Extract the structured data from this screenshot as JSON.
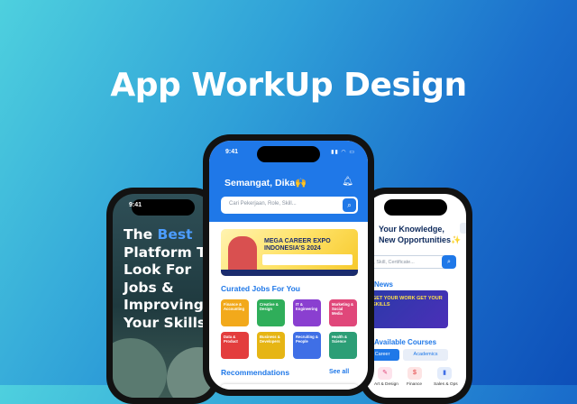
{
  "headline": "App WorkUp Design",
  "status_time": "9:41",
  "left_phone": {
    "lines": [
      {
        "pre": "The ",
        "accent": "Best",
        "post": ""
      },
      {
        "pre": "Platform T",
        "accent": "",
        "post": ""
      },
      {
        "pre": "Look For",
        "accent": "",
        "post": ""
      },
      {
        "pre": "Jobs &",
        "accent": "",
        "post": ""
      },
      {
        "pre": "Improving",
        "accent": "",
        "post": ""
      },
      {
        "pre": "Your Skills",
        "accent": "",
        "post": ""
      }
    ]
  },
  "center_phone": {
    "greeting": "Semangat, Dika🙌",
    "search_placeholder": "Cari Pekerjaan, Role, Skill...",
    "banner_title": "MEGA CAREER EXPO INDONESIA'S 2024",
    "curated_title": "Curated Jobs For You",
    "categories": [
      {
        "label": "Finance & Accounting",
        "color": "#f2a91b"
      },
      {
        "label": "Creative & Design",
        "color": "#2fae5a"
      },
      {
        "label": "IT & Engineering",
        "color": "#8a3fd0"
      },
      {
        "label": "Marketing & Social Media",
        "color": "#e0477a"
      },
      {
        "label": "Data & Product",
        "color": "#e33d3d"
      },
      {
        "label": "Business & Developers",
        "color": "#e6b514"
      },
      {
        "label": "Recruiting & People",
        "color": "#3f6fe6"
      },
      {
        "label": "Health & Science",
        "color": "#2c9e76"
      }
    ],
    "recommendations_title": "Recommendations",
    "see_all": "See all"
  },
  "right_phone": {
    "title_line1": "Your Knowledge,",
    "title_line2": "New Opportunities✨",
    "search_placeholder": "le, Skill, Certificate...",
    "news_title": "News",
    "banner_text": "GET YOUR WORK GET YOUR SKILLS",
    "available_title": "Available Courses",
    "tabs": [
      "Career",
      "Academics"
    ],
    "courses": [
      "Art & Design",
      "Finance",
      "Sales & Ops"
    ]
  },
  "colors": {
    "primary": "#1f78e8",
    "accent": "#4c9dff"
  }
}
